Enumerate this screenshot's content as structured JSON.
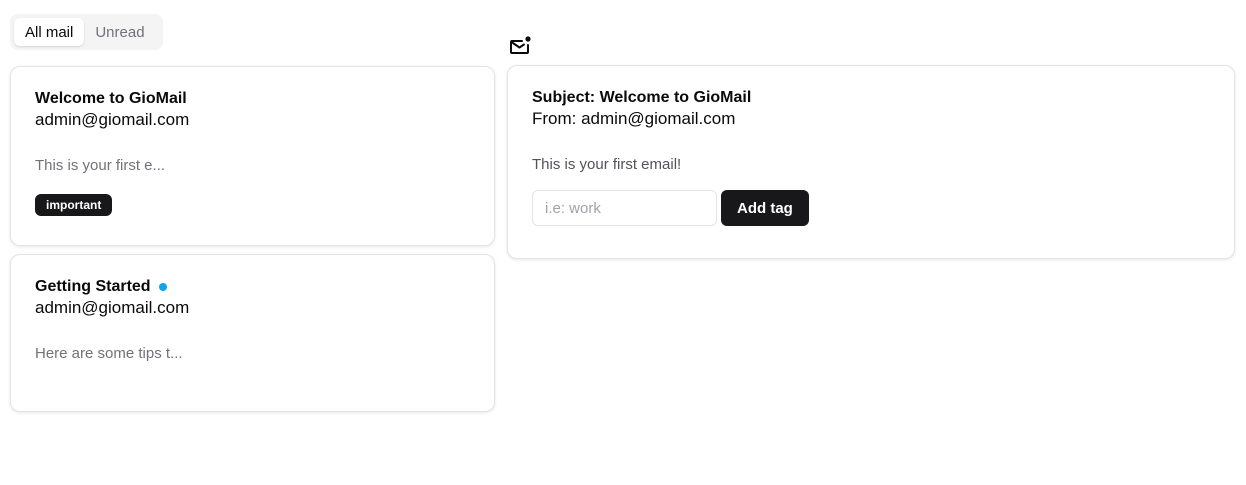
{
  "tabs": [
    {
      "label": "All mail",
      "active": true
    },
    {
      "label": "Unread",
      "active": false
    }
  ],
  "toolbar": {
    "icon": "mail-unread-icon"
  },
  "mails": [
    {
      "title": "Welcome to GioMail",
      "sender": "admin@giomail.com",
      "preview": "This is your first e...",
      "tag": "important",
      "unread": false
    },
    {
      "title": "Getting Started",
      "sender": "admin@giomail.com",
      "preview": "Here are some tips t...",
      "unread": true
    }
  ],
  "detail": {
    "subject": "Subject: Welcome to GioMail",
    "from": "From: admin@giomail.com",
    "body": "This is your first email!",
    "tag_placeholder": "i.e: work",
    "add_tag_label": "Add tag"
  },
  "colors": {
    "unread_dot": "#0ea5e9",
    "primary": "#18181b",
    "muted_text": "#71717a",
    "border": "#e4e4e7"
  }
}
